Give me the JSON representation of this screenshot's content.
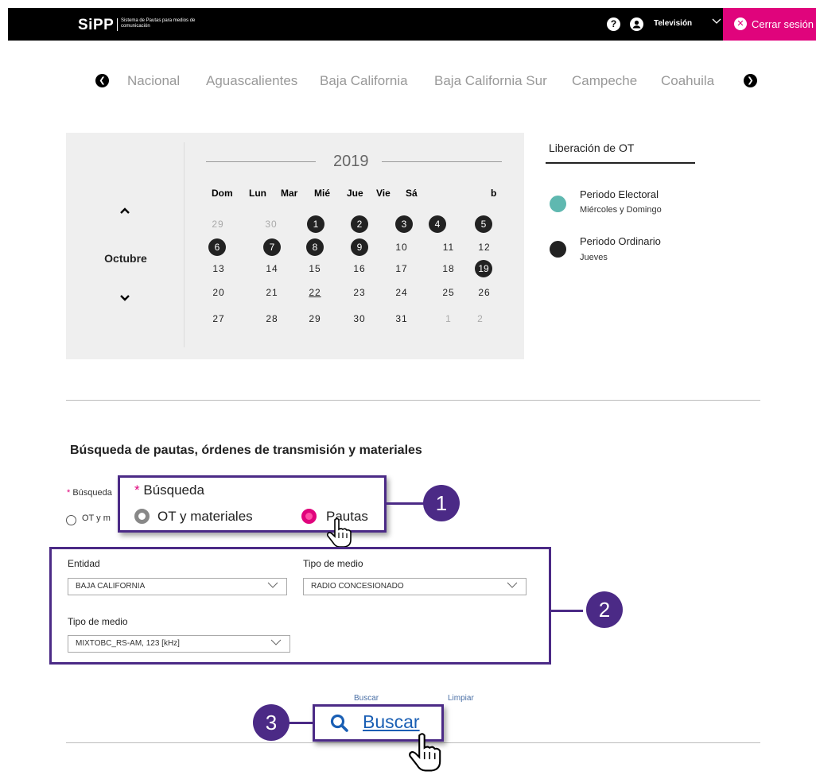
{
  "header": {
    "logo": "SiPP",
    "logo_sub": "Sistema de Pautas para medios de comunicación",
    "media_type": "Televisión",
    "logout_label": "Cerrar sesión",
    "accent_color": "#e0047c"
  },
  "states": [
    "Nacional",
    "Aguascalientes",
    "Baja California",
    "Baja California Sur",
    "Campeche",
    "Coahuila"
  ],
  "calendar": {
    "year": "2019",
    "month": "Octubre",
    "weekdays": [
      "Dom",
      "Lun",
      "Mar",
      "Mié",
      "Jue",
      "Vie",
      "Sá",
      "b"
    ],
    "weeks": [
      [
        "29",
        "30",
        "1",
        "2",
        "3",
        "4",
        "5"
      ],
      [
        "6",
        "7",
        "8",
        "9",
        "10",
        "11",
        "12"
      ],
      [
        "13",
        "14",
        "15",
        "16",
        "17",
        "18",
        "19"
      ],
      [
        "20",
        "21",
        "22",
        "23",
        "24",
        "25",
        "26"
      ],
      [
        "27",
        "28",
        "29",
        "30",
        "31",
        "1",
        "2"
      ]
    ]
  },
  "legend": {
    "title": "Liberación de OT",
    "electoral": {
      "title": "Periodo Electoral",
      "sub": "Miércoles y Domingo",
      "color": "#5fb8b0"
    },
    "ordinario": {
      "title": "Periodo Ordinario",
      "sub": "Jueves",
      "color": "#222222"
    }
  },
  "search": {
    "title": "Búsqueda de pautas, órdenes de transmisión y materiales",
    "busqueda_label": "Búsqueda",
    "bg_label": "Búsqueda",
    "bg_radio": "OT y m",
    "option_ot": "OT y materiales",
    "option_pautas": "Pautas"
  },
  "filters": {
    "entidad_label": "Entidad",
    "entidad_value": "BAJA CALIFORNIA",
    "tipo_medio_label": "Tipo de medio",
    "tipo_medio_value": "RADIO CONCESIONADO",
    "tipo_medio2_label": "Tipo de medio",
    "tipo_medio2_value": "MIXTOBC_RS-AM, 123 [kHz]"
  },
  "actions": {
    "buscar_small": "Buscar",
    "limpiar": "Limpiar",
    "buscar": "Buscar"
  },
  "callouts": [
    "1",
    "2",
    "3"
  ],
  "brand_purple": "#4b2a86"
}
